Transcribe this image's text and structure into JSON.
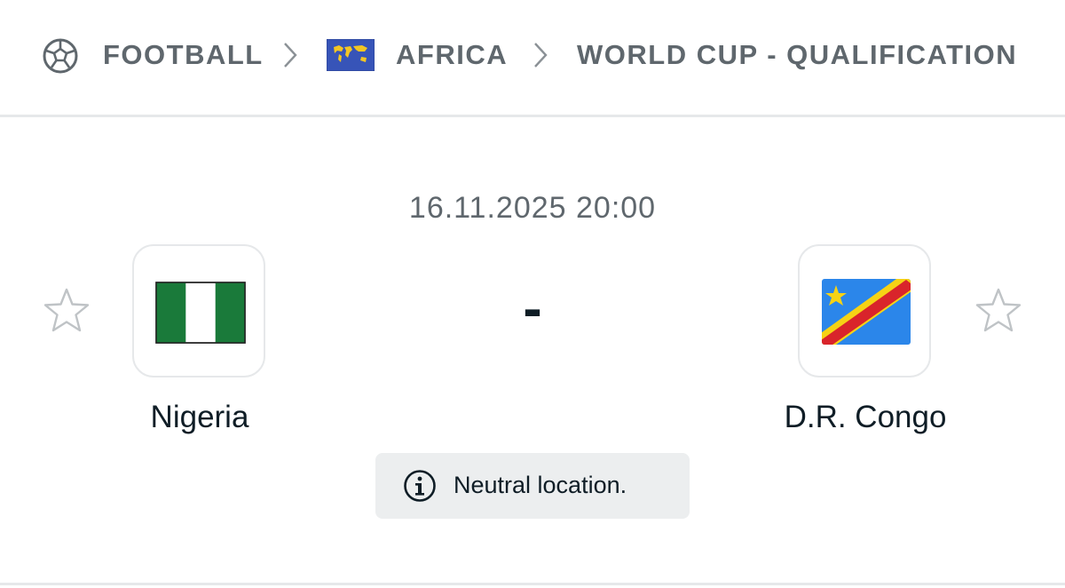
{
  "breadcrumb": {
    "sport": {
      "label": "FOOTBALL",
      "icon": "football-icon"
    },
    "region": {
      "label": "AFRICA",
      "icon": "africa-flag-icon"
    },
    "competition": {
      "label": "WORLD CUP - QUALIFICATION"
    },
    "separator_icon": "chevron-right-icon"
  },
  "match": {
    "datetime": "16.11.2025 20:00",
    "score": "-",
    "home_team": {
      "name": "Nigeria",
      "flag_icon": "nigeria-flag-icon"
    },
    "away_team": {
      "name": "D.R. Congo",
      "flag_icon": "dr-congo-flag-icon"
    },
    "favorite_icon": "star-outline-icon",
    "info": {
      "icon": "info-icon",
      "text": "Neutral location."
    }
  },
  "colors": {
    "text_primary": "#0f1d26",
    "text_secondary": "#5f676d",
    "divider": "#e6e8ea",
    "pill_background": "#eceeef",
    "nigeria_green": "#1a7a3a",
    "congo_blue": "#2b86ea",
    "congo_red": "#d9242b",
    "congo_yellow": "#f6d215"
  }
}
